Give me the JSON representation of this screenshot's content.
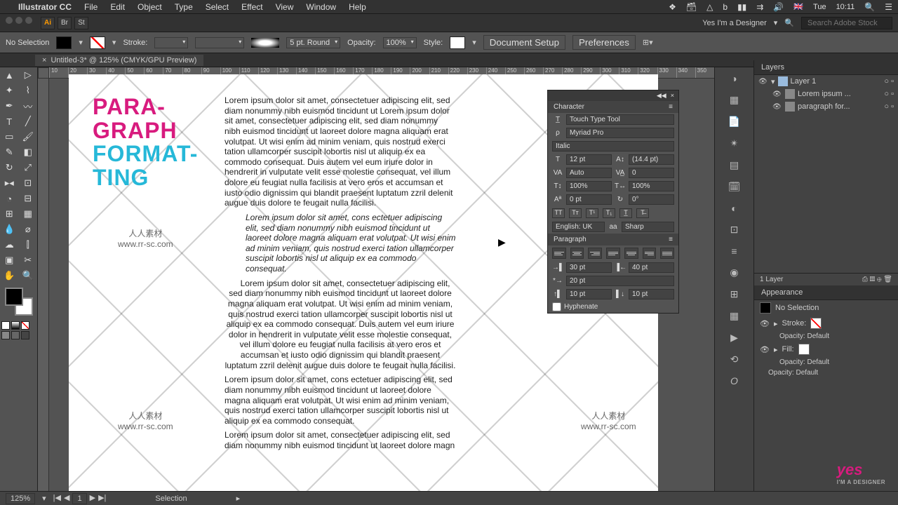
{
  "menubar": {
    "app": "Illustrator CC",
    "items": [
      "File",
      "Edit",
      "Object",
      "Type",
      "Select",
      "Effect",
      "View",
      "Window",
      "Help"
    ],
    "right": {
      "lang": "🇬🇧",
      "day": "Tue",
      "time": "10:11"
    }
  },
  "topbar": {
    "account": "Yes I'm a Designer",
    "search_placeholder": "Search Adobe Stock"
  },
  "controlbar": {
    "selection": "No Selection",
    "stroke_label": "Stroke:",
    "brush": "5 pt. Round",
    "opacity_label": "Opacity:",
    "opacity": "100%",
    "style_label": "Style:",
    "doc_setup": "Document Setup",
    "prefs": "Preferences"
  },
  "tab": {
    "title": "Untitled-3* @ 125% (CMYK/GPU Preview)",
    "close": "×"
  },
  "ruler_ticks": [
    "10",
    "20",
    "30",
    "40",
    "50",
    "60",
    "70",
    "80",
    "90",
    "100",
    "110",
    "120",
    "130",
    "140",
    "150",
    "160",
    "170",
    "180",
    "190",
    "200",
    "210",
    "220",
    "230",
    "240",
    "250",
    "260",
    "270",
    "280",
    "290",
    "300",
    "310",
    "320",
    "330",
    "340",
    "350"
  ],
  "artboard": {
    "title1a": "PARA-",
    "title1b": "GRAPH",
    "title2a": "FORMAT-",
    "title2b": "TING",
    "p1": "Lorem ipsum dolor sit amet, consectetuer adipiscing elit, sed diam nonummy nibh euismod tincidunt ut Lorem ipsum dolor sit amet, consectetuer adipiscing elit, sed diam nonummy nibh euismod tincidunt ut laoreet dolore magna aliquam erat volutpat. Ut wisi enim ad minim veniam, quis nostrud exerci tation ullamcorper suscipit lobortis nisl ut aliquip ex ea commodo consequat. Duis autem vel eum iriure dolor in hendrerit in vulputate velit esse molestie consequat, vel illum dolore eu feugiat nulla facilisis at vero eros et accumsan et iusto odio dignissim qui blandit praesent luptatum zzril delenit augue duis dolore te feugait nulla facilisi.",
    "p2": "Lorem ipsum dolor sit amet, cons ectetuer adipiscing elit, sed diam nonummy nibh euismod tincidunt ut laoreet dolore magna aliquam erat volutpat. Ut wisi enim ad minim veniam, quis nostrud exerci tation ullamcorper suscipit lobortis nisl ut aliquip ex ea commodo consequat.",
    "p3": "Lorem ipsum dolor sit amet, consectetuer adipiscing elit, sed diam nonummy nibh euismod tincidunt ut laoreet dolore magna aliquam erat volutpat. Ut wisi enim ad minim veniam, quis nostrud exerci tation ullamcorper suscipit lobortis nisl ut aliquip ex ea commodo consequat. Duis autem vel eum iriure dolor in hendrerit in vulputate velit esse molestie consequat, vel illum dolore eu feugiat nulla facilisis at vero eros et accumsan et iusto odio dignissim qui blandit praesent luptatum zzril delenit augue duis dolore te feugait nulla facilisi.",
    "p4": "Lorem ipsum dolor sit amet, cons ectetuer adipiscing elit, sed diam nonummy nibh euismod tincidunt ut laoreet dolore magna aliquam erat volutpat. Ut wisi enim ad minim veniam, quis nostrud exerci tation ullamcorper suscipit lobortis nisl ut aliquip ex ea commodo consequat.",
    "p5": "Lorem ipsum dolor sit amet, consectetuer adipiscing elit, sed diam nonummy nibh euismod tincidunt ut laoreet dolore magn"
  },
  "character": {
    "title": "Character",
    "touch": "Touch Type Tool",
    "font": "Myriad Pro",
    "style": "Italic",
    "size": "12 pt",
    "leading": "(14.4 pt)",
    "kerning": "Auto",
    "tracking": "0",
    "vscale": "100%",
    "hscale": "100%",
    "baseline": "0 pt",
    "rotation": "0°",
    "lang": "English: UK",
    "aa": "Sharp"
  },
  "paragraph": {
    "title": "Paragraph",
    "left_indent": "30 pt",
    "right_indent": "40 pt",
    "first_indent": "20 pt",
    "space_before": "10 pt",
    "space_after": "10 pt",
    "hyphenate": "Hyphenate"
  },
  "layers": {
    "title": "Layers",
    "layer1": "Layer 1",
    "sub1": "Lorem ipsum ...",
    "sub2": "paragraph for...",
    "footer": "1 Layer"
  },
  "appearance": {
    "title": "Appearance",
    "nosel": "No Selection",
    "stroke": "Stroke:",
    "fill": "Fill:",
    "opacity": "Opacity:",
    "default": "Default"
  },
  "status": {
    "zoom": "125%",
    "tool": "Selection"
  },
  "watermark": {
    "cn": "人人素材",
    "url": "www.rr-sc.com"
  },
  "yes": {
    "logo": "yes",
    "sub": "I'M A DESIGNER"
  }
}
